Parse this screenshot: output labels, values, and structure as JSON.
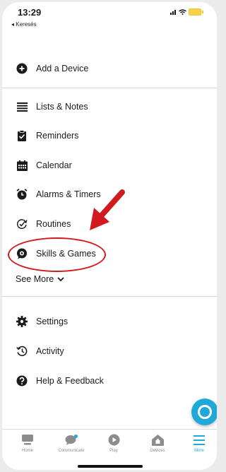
{
  "status_bar": {
    "time": "13:29",
    "back_label": "◂ Keresés"
  },
  "menu": {
    "add_device": "Add a Device",
    "lists_notes": "Lists & Notes",
    "reminders": "Reminders",
    "calendar": "Calendar",
    "alarms_timers": "Alarms & Timers",
    "routines": "Routines",
    "skills_games": "Skills & Games",
    "see_more": "See More",
    "settings": "Settings",
    "activity": "Activity",
    "help_feedback": "Help & Feedback"
  },
  "tabs": {
    "home": "Home",
    "communicate": "Communicate",
    "play": "Play",
    "devices": "Devices",
    "more": "More"
  },
  "colors": {
    "accent": "#1fa9d9",
    "annotation": "#d01a1f"
  }
}
